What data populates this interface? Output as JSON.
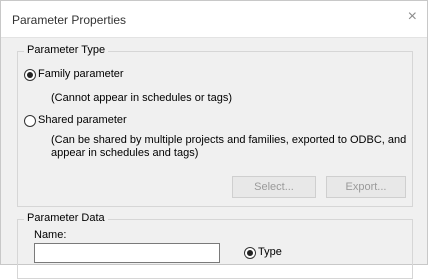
{
  "window": {
    "title": "Parameter Properties",
    "close_glyph": "×"
  },
  "parameter_type": {
    "legend": "Parameter Type",
    "family_label": "Family parameter",
    "family_note": "(Cannot appear in schedules or tags)",
    "shared_label": "Shared parameter",
    "shared_note_line1": "(Can be shared by multiple projects and families, exported to ODBC, and",
    "shared_note_line2": "appear in schedules and tags)",
    "select_button": "Select...",
    "export_button": "Export..."
  },
  "parameter_data": {
    "legend": "Parameter Data",
    "name_label": "Name:",
    "name_value": "",
    "type_label": "Type"
  },
  "colors": {
    "dialog_bg": "#f0f0f0",
    "disabled_text": "#9a9a9a"
  }
}
